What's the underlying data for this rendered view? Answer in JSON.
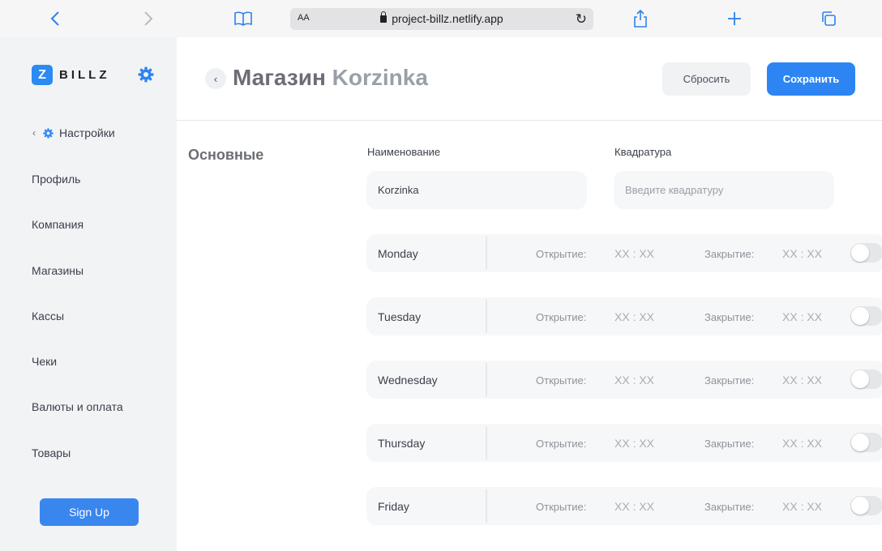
{
  "browser": {
    "text_size_label": "AA",
    "url": "project-billz.netlify.app"
  },
  "sidebar": {
    "logo_letter": "Z",
    "logo_text": "BILLZ",
    "back_label": "Настройки",
    "items": [
      {
        "label": "Профиль"
      },
      {
        "label": "Компания"
      },
      {
        "label": "Магазины"
      },
      {
        "label": "Кассы"
      },
      {
        "label": "Чеки"
      },
      {
        "label": "Валюты и оплата"
      },
      {
        "label": "Товары"
      }
    ],
    "signup_label": "Sign Up"
  },
  "header": {
    "title_prefix": "Магазин",
    "title_store": "Korzinka",
    "reset_label": "Сбросить",
    "save_label": "Сохранить"
  },
  "form": {
    "section_title": "Основные",
    "name_label": "Наименование",
    "name_value": "Korzinka",
    "area_label": "Квадратура",
    "area_placeholder": "Введите квадратуру"
  },
  "schedule": {
    "open_label": "Открытие:",
    "close_label": "Закрытие:",
    "days": [
      {
        "name": "Monday",
        "open": "XX : XX",
        "close": "XX : XX",
        "enabled": false
      },
      {
        "name": "Tuesday",
        "open": "XX : XX",
        "close": "XX : XX",
        "enabled": false
      },
      {
        "name": "Wednesday",
        "open": "XX : XX",
        "close": "XX : XX",
        "enabled": false
      },
      {
        "name": "Thursday",
        "open": "XX : XX",
        "close": "XX : XX",
        "enabled": false
      },
      {
        "name": "Friday",
        "open": "XX : XX",
        "close": "XX : XX",
        "enabled": false
      }
    ]
  },
  "colors": {
    "accent": "#2d85f3",
    "sidebar_bg": "#f2f3f5"
  }
}
